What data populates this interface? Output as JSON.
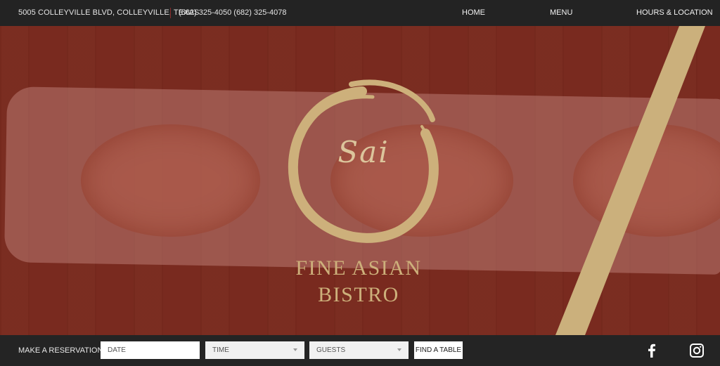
{
  "topbar": {
    "address": "5005 COLLEYVILLE BLVD, COLLEYVILLE, TEXAS",
    "phones": "(682) 325-4050 (682) 325-4078",
    "nav": [
      {
        "label": "HOME"
      },
      {
        "label": "MENU"
      },
      {
        "label": "HOURS & LOCATION"
      }
    ]
  },
  "hero": {
    "logo_text": "Sai",
    "tagline_line1": "FINE ASIAN",
    "tagline_line2": "BISTRO",
    "accent_color": "#cdb07b",
    "overlay_color": "#7a2f22"
  },
  "reservation": {
    "label": "MAKE A RESERVATION",
    "date_placeholder": "DATE",
    "time_placeholder": "TIME",
    "guests_placeholder": "GUESTS",
    "button": "FIND A TABLE"
  },
  "social": [
    {
      "icon": "facebook-icon"
    },
    {
      "icon": "instagram-icon"
    }
  ]
}
